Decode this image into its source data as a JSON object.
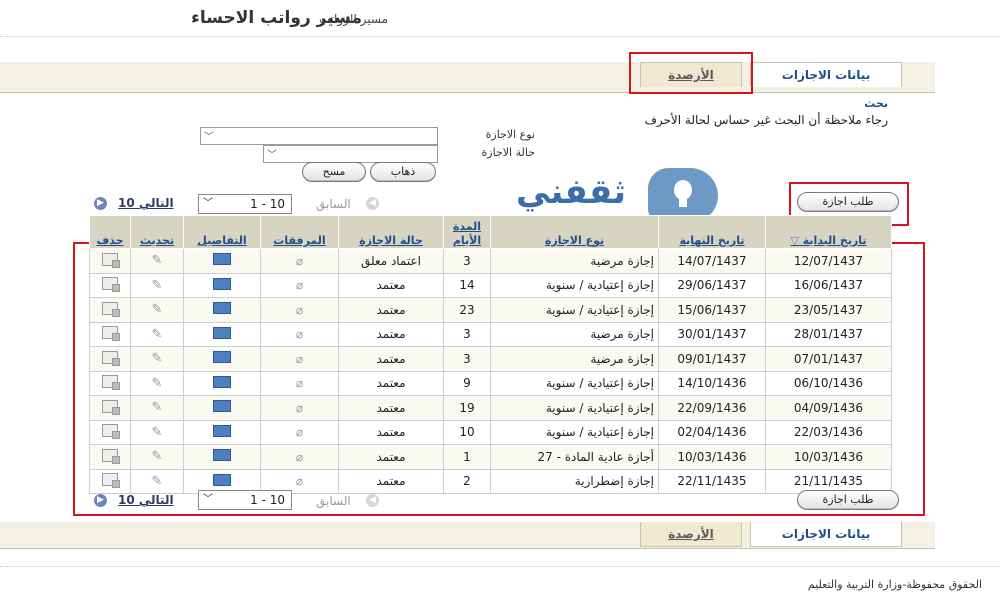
{
  "header": {
    "title": "مسير رواتب الاحساء",
    "subtitle": "مسير الرواتب"
  },
  "tabs": {
    "active": "بيانات الاجازات",
    "inactive": "الأرصدة"
  },
  "search": {
    "heading": "بحث",
    "note": "رجاء ملاحظة أن البحث غير حساس لحالة الأحرف",
    "leave_type_label": "نوع الاجازة",
    "leave_status_label": "حالة الاجازة",
    "go_button": "ذهاب",
    "clear_button": "مسح"
  },
  "actions": {
    "request_leave": "طلب اجازة"
  },
  "nav": {
    "prev": "السابق",
    "range": "1 - 10",
    "next": "10 التالي"
  },
  "brand": {
    "name": "ثقفني"
  },
  "table": {
    "headers": {
      "start_date": "تاريخ البداية",
      "end_date": "تاريخ النهاية",
      "leave_type": "نوع الاجازة",
      "duration": "المدة الأيام",
      "status": "حالة الاجازة",
      "attachments": "المرفقات",
      "details": "التفاصيل",
      "update": "تحديث",
      "delete": "حذف"
    },
    "rows": [
      {
        "start": "12/07/1437",
        "end": "14/07/1437",
        "type": "إجازة مرضية",
        "days": "3",
        "status": "اعتماد معلق"
      },
      {
        "start": "16/06/1437",
        "end": "29/06/1437",
        "type": "إجازة إعتيادية / سنوية",
        "days": "14",
        "status": "معتمد"
      },
      {
        "start": "23/05/1437",
        "end": "15/06/1437",
        "type": "إجازة إعتيادية / سنوية",
        "days": "23",
        "status": "معتمد"
      },
      {
        "start": "28/01/1437",
        "end": "30/01/1437",
        "type": "إجازة مرضية",
        "days": "3",
        "status": "معتمد"
      },
      {
        "start": "07/01/1437",
        "end": "09/01/1437",
        "type": "إجازة مرضية",
        "days": "3",
        "status": "معتمد"
      },
      {
        "start": "06/10/1436",
        "end": "14/10/1436",
        "type": "إجازة إعتيادية / سنوية",
        "days": "9",
        "status": "معتمد"
      },
      {
        "start": "04/09/1436",
        "end": "22/09/1436",
        "type": "إجازة إعتيادية / سنوية",
        "days": "19",
        "status": "معتمد"
      },
      {
        "start": "22/03/1436",
        "end": "02/04/1436",
        "type": "إجازة إعتيادية / سنوية",
        "days": "10",
        "status": "معتمد"
      },
      {
        "start": "10/03/1436",
        "end": "10/03/1436",
        "type": "أجازة عادية المادة - 27",
        "days": "1",
        "status": "معتمد"
      },
      {
        "start": "21/11/1435",
        "end": "22/11/1435",
        "type": "إجازة إضطرارية",
        "days": "2",
        "status": "معتمد"
      }
    ]
  },
  "footer": {
    "text": "الحقوق محفوظة-وزارة التربية والتعليم"
  }
}
